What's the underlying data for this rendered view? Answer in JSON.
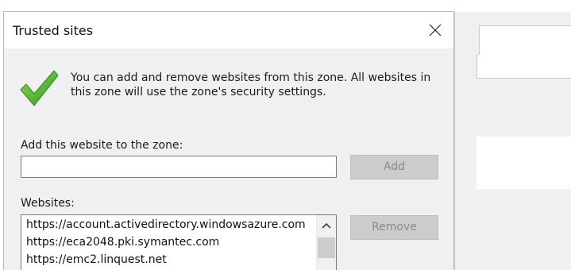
{
  "dialog": {
    "title": "Trusted sites",
    "info_text": "You can add and remove websites from this zone. All websites in this zone will use the zone's security settings.",
    "add_label": "Add this website to the zone:",
    "website_input_value": "",
    "add_button": "Add",
    "websites_label": "Websites:",
    "websites": [
      "https://account.activedirectory.windowsazure.com",
      "https://eca2048.pki.symantec.com",
      "https://emc2.linquest.net"
    ],
    "remove_button": "Remove"
  },
  "icons": {
    "close": "close-icon",
    "check": "check-icon",
    "scroll_up": "chevron-up-icon"
  },
  "colors": {
    "check_green": "#4caf2a",
    "dialog_bg": "#f0f0f0",
    "button_disabled_bg": "#cccccc",
    "button_disabled_text": "#8a8a8a"
  }
}
